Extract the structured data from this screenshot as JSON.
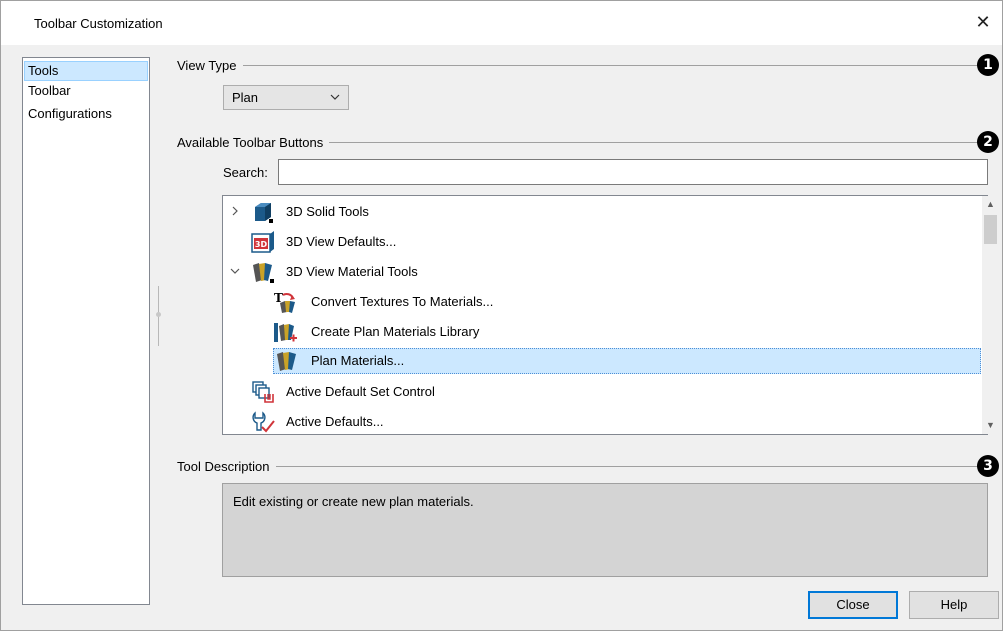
{
  "window": {
    "title": "Toolbar Customization",
    "close_glyph": "✕"
  },
  "sidebar": {
    "items": [
      {
        "label": "Tools",
        "selected": true
      },
      {
        "label": "Toolbar",
        "selected": false
      },
      {
        "label": "Configurations",
        "selected": false
      }
    ]
  },
  "view_type": {
    "label": "View Type",
    "value": "Plan",
    "badge": "1"
  },
  "available": {
    "label": "Available Toolbar Buttons",
    "badge": "2"
  },
  "search": {
    "label": "Search:",
    "value": "",
    "placeholder": ""
  },
  "tree": {
    "items": [
      {
        "label": "3D Solid Tools",
        "icon": "3d-solid-tools-icon",
        "expander": "collapsed"
      },
      {
        "label": "3D View Defaults...",
        "icon": "3d-view-defaults-icon",
        "expander": "none"
      },
      {
        "label": "3D View Material Tools",
        "icon": "material-tools-icon",
        "expander": "expanded"
      },
      {
        "label": "Convert Textures To Materials...",
        "icon": "convert-textures-icon",
        "expander": "none",
        "child": true
      },
      {
        "label": "Create Plan Materials Library",
        "icon": "create-materials-library-icon",
        "expander": "none",
        "child": true
      },
      {
        "label": "Plan Materials...",
        "icon": "plan-materials-icon",
        "expander": "none",
        "child": true,
        "selected": true
      },
      {
        "label": "Active Default Set Control",
        "icon": "active-default-set-icon",
        "expander": "none"
      },
      {
        "label": "Active Defaults...",
        "icon": "active-defaults-icon",
        "expander": "none"
      }
    ]
  },
  "description": {
    "label": "Tool Description",
    "text": "Edit existing or create new plan materials.",
    "badge": "3"
  },
  "buttons": {
    "close": "Close",
    "help": "Help"
  },
  "colors": {
    "selection": "#cce8ff",
    "accent": "#0078d7",
    "icon_blue": "#1c5a8a",
    "icon_red": "#d0343a"
  }
}
